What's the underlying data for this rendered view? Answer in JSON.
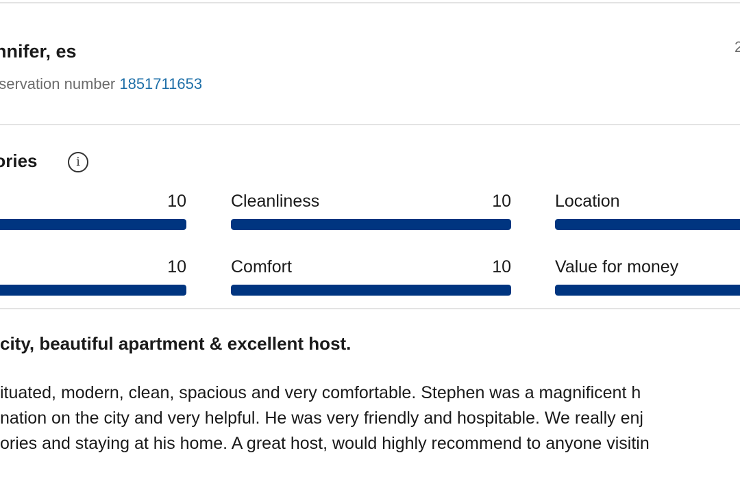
{
  "reviewer": {
    "name": "ennifer, es",
    "reservation_label": "eservation number",
    "reservation_number": "1851711653",
    "date_fragment": "2"
  },
  "categories": {
    "title": "egories",
    "info_icon": "info-icon",
    "items": [
      {
        "label": "",
        "score": "10",
        "fill": 1.0
      },
      {
        "label": "Cleanliness",
        "score": "10",
        "fill": 1.0
      },
      {
        "label": "Location",
        "score": "",
        "fill": 1.0
      },
      {
        "label": "",
        "score": "10",
        "fill": 1.0
      },
      {
        "label": "Comfort",
        "score": "10",
        "fill": 1.0
      },
      {
        "label": "Value for money",
        "score": "",
        "fill": 1.0
      }
    ]
  },
  "review": {
    "title": "city, beautiful apartment & excellent host.",
    "lines": [
      "ituated, modern, clean, spacious and very comfortable. Stephen was a magnificent h",
      "nation on the city and very helpful. He was very friendly and hospitable. We really enj",
      "ories and staying at his home. A great host, would highly recommend to anyone visitin"
    ]
  },
  "colors": {
    "bar_fill": "#003580",
    "link": "#1e6fa8",
    "muted_text": "#6b6b6b",
    "divider": "#e3e3e3"
  }
}
